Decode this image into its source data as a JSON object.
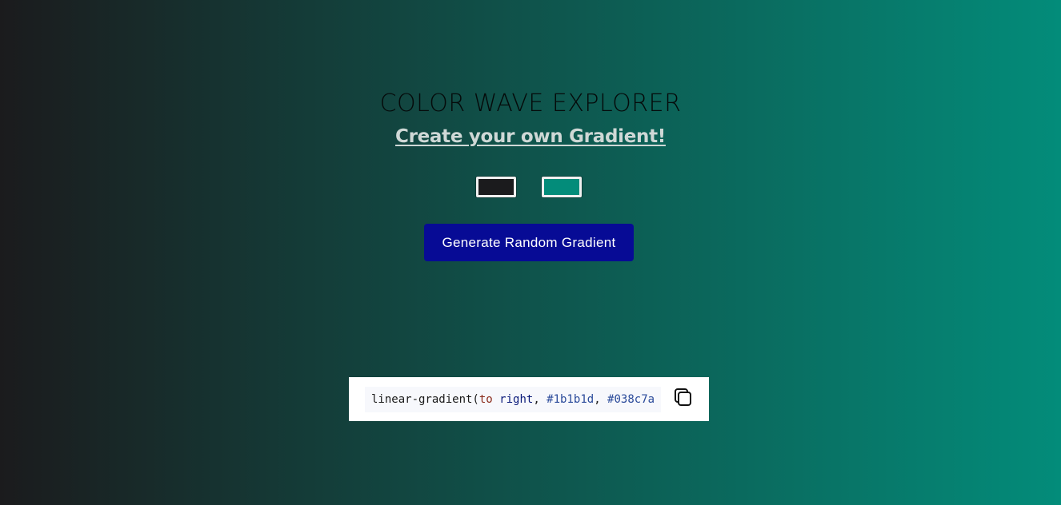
{
  "header": {
    "title": "COLOR WAVE EXPLORER",
    "subtitle": "Create your own Gradient!"
  },
  "pickers": {
    "color1": "#1b1b1d",
    "color2": "#038c7a"
  },
  "button": {
    "label": "Generate Random Gradient",
    "color": "#070b95"
  },
  "code": {
    "fn": "linear-gradient(",
    "direction_kw": "to",
    "direction_val": "right",
    "color1": "#1b1b1d",
    "color2": "#038c7a",
    "sep": ", "
  },
  "icons": {
    "copy": "copy-icon"
  }
}
